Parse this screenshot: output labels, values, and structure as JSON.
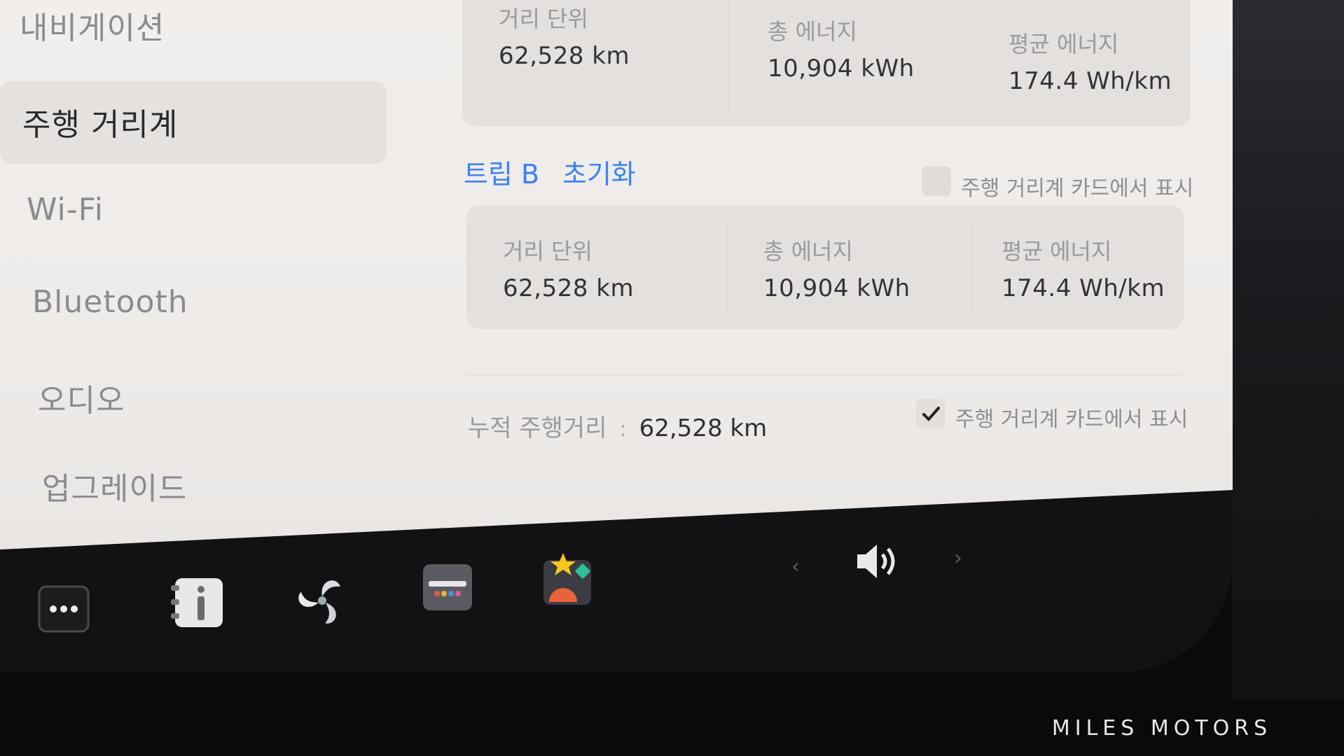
{
  "sidebar": {
    "items": [
      {
        "label": "내비게이션"
      },
      {
        "label": "주행 거리계"
      },
      {
        "label": "Wi-Fi"
      },
      {
        "label": "Bluetooth"
      },
      {
        "label": "오디오"
      },
      {
        "label": "업그레이드"
      }
    ]
  },
  "trip_a": {
    "distance": {
      "label": "거리 단위",
      "value": "62,528 km"
    },
    "energy": {
      "label": "총 에너지",
      "value": "10,904 kWh"
    },
    "avg": {
      "label": "평균 에너지",
      "value": "174.4 Wh/km"
    }
  },
  "trip_b": {
    "title": "트립 B",
    "reset_label": "초기화",
    "show_on_card": {
      "label": "주행 거리계 카드에서 표시",
      "checked": false
    },
    "distance": {
      "label": "거리 단위",
      "value": "62,528 km"
    },
    "energy": {
      "label": "총 에너지",
      "value": "10,904 kWh"
    },
    "avg": {
      "label": "평균 에너지",
      "value": "174.4 Wh/km"
    }
  },
  "odometer": {
    "label": "누적 주행거리",
    "separator": ":",
    "value": "62,528 km",
    "show_on_card": {
      "label": "주행 거리계 카드에서 표시",
      "checked": true
    }
  },
  "taskbar": {
    "icons": [
      "more-icon",
      "manual-info-icon",
      "fan-icon",
      "toybox-icon",
      "arcade-icon"
    ],
    "volume_icon": "volume-icon"
  },
  "watermark": "MILES MOTORS",
  "colors": {
    "accent": "#3b82f6",
    "panel": "#eeebe9",
    "taskbar": "#121214"
  }
}
